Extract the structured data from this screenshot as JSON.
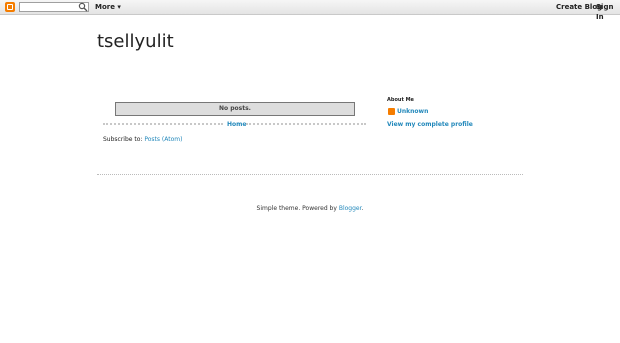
{
  "navbar": {
    "search_placeholder": "",
    "more_label": "More",
    "create_blog_label": "Create Blog",
    "sign_in_label": "Sign In"
  },
  "blog": {
    "title": "tsellyulit"
  },
  "main": {
    "status_message": "No posts.",
    "home_link": "Home",
    "subscribe_prefix": "Subscribe to: ",
    "subscribe_link": "Posts (Atom)"
  },
  "sidebar": {
    "about_title": "About Me",
    "profile_name": "Unknown",
    "profile_link": "View my complete profile"
  },
  "footer": {
    "text_prefix": "Simple theme. Powered by ",
    "link": "Blogger",
    "text_suffix": "."
  },
  "colors": {
    "link": "#2288bb",
    "blogger_orange": "#f57d00"
  }
}
